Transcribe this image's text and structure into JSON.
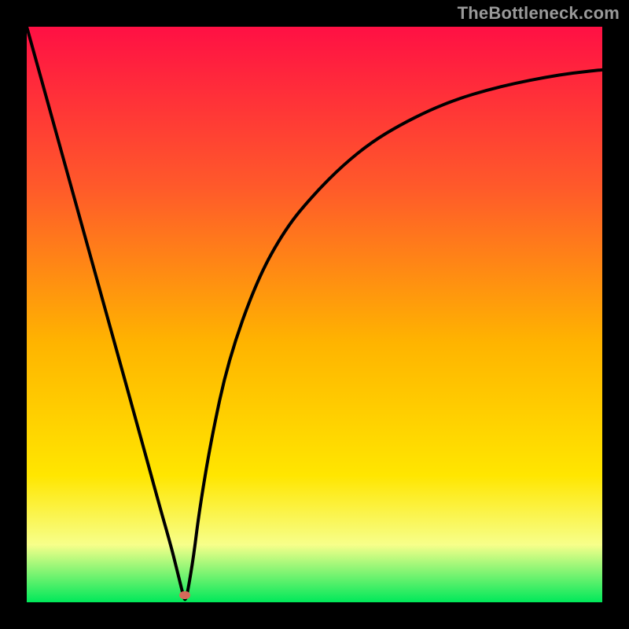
{
  "watermark": "TheBottleneck.com",
  "colors": {
    "frame": "#000000",
    "gradient_top": "#ff1044",
    "gradient_mid_upper": "#ff5a2a",
    "gradient_mid": "#ffb400",
    "gradient_mid_lower": "#ffe600",
    "gradient_lower": "#f7ff8a",
    "gradient_bottom": "#00e85a",
    "curve": "#000000",
    "marker": "#d46a5a"
  },
  "marker_position": {
    "x_pct": 27.5,
    "y_pct": 98.8
  },
  "chart_data": {
    "type": "line",
    "title": "",
    "xlabel": "",
    "ylabel": "",
    "xlim": [
      0,
      100
    ],
    "ylim": [
      0,
      100
    ],
    "series": [
      {
        "name": "bottleneck-curve",
        "x": [
          0,
          5,
          10,
          15,
          20,
          23,
          25,
          26,
          27,
          27.5,
          28,
          29,
          30,
          32,
          35,
          40,
          45,
          50,
          55,
          60,
          65,
          70,
          75,
          80,
          85,
          90,
          95,
          100
        ],
        "y": [
          100,
          82,
          64,
          46,
          28,
          17,
          10,
          6,
          2,
          0,
          2,
          8,
          16,
          28,
          42,
          56,
          65,
          71,
          76,
          80,
          83,
          85.5,
          87.5,
          89,
          90.2,
          91.2,
          92,
          92.5
        ]
      }
    ],
    "annotations": [
      {
        "type": "marker",
        "x": 27.5,
        "y": 0,
        "shape": "ellipse"
      }
    ]
  }
}
